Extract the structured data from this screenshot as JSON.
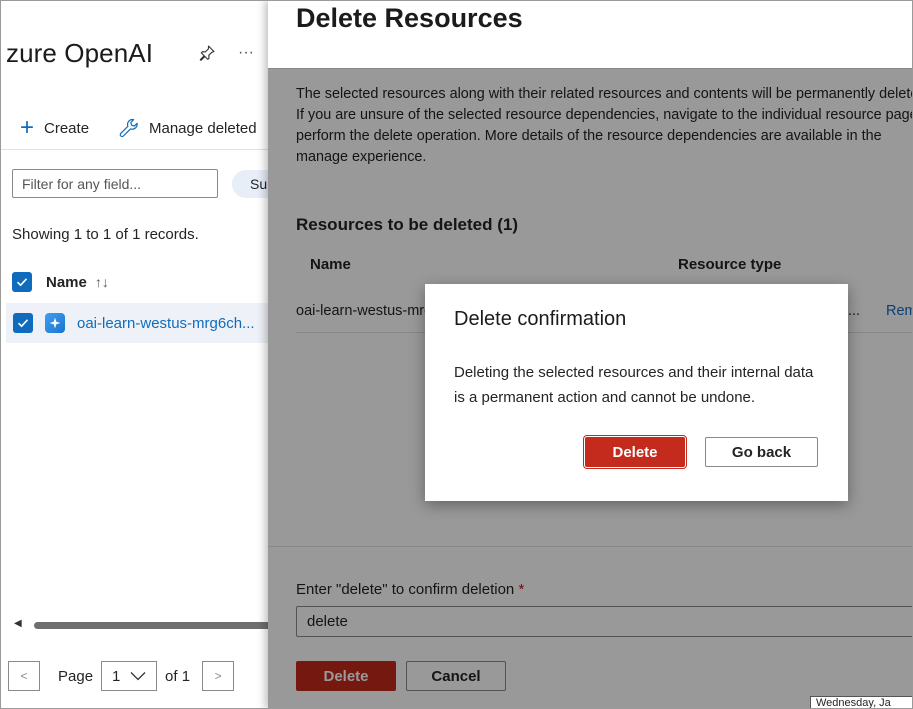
{
  "left_blade": {
    "title": "zure OpenAI",
    "more_label": "···",
    "toolbar": {
      "create_label": "Create",
      "manage_label": "Manage deleted"
    },
    "filter": {
      "placeholder": "Filter for any field..."
    },
    "subscription_pill": "Su",
    "records_text": "Showing 1 to 1 of 1 records.",
    "table": {
      "name_header": "Name",
      "sort_icon": "↑↓",
      "rows": [
        {
          "name": "oai-learn-westus-mrg6ch..."
        }
      ]
    },
    "pager": {
      "prev_label": "<",
      "page_label": "Page",
      "current_page": "1",
      "of_label": "of 1",
      "next_label": ">"
    }
  },
  "panel": {
    "title": "Delete Resources",
    "description": "The selected resources along with their related resources and contents will be permanently deleted. If you are unsure of the selected resource dependencies, navigate to the individual resource page to perform the delete operation. More details of the resource dependencies are available in the manage experience.",
    "section_title": "Resources to be deleted (1)",
    "columns": {
      "name": "Name",
      "resource_type": "Resource type"
    },
    "rows": [
      {
        "name": "oai-learn-westus-mrg6ch",
        "type_truncated": "...",
        "action": "Remove"
      }
    ],
    "confirm_label": "Enter \"delete\" to confirm deletion",
    "required_mark": "*",
    "confirm_value": "delete",
    "delete_label": "Delete",
    "cancel_label": "Cancel"
  },
  "modal": {
    "title": "Delete confirmation",
    "body": "Deleting the selected resources and their internal data is a permanent action and cannot be undone.",
    "delete_label": "Delete",
    "goback_label": "Go back"
  },
  "tooltip": "Wednesday, Ja",
  "colors": {
    "accent": "#0f6cbd",
    "danger": "#c42b1c",
    "overlay": "rgba(0,0,0,0.40)"
  },
  "icons": {
    "create": "plus-icon",
    "manage": "wrench-icon",
    "pin": "pin-icon",
    "resource": "azure-openai-icon"
  }
}
